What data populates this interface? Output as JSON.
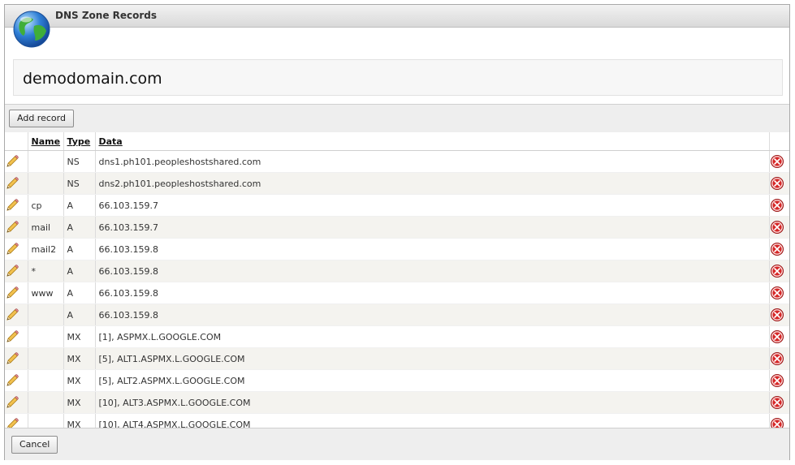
{
  "window": {
    "title": "DNS Zone Records"
  },
  "zone": {
    "domain": "demodomain.com"
  },
  "toolbar": {
    "add_label": "Add record"
  },
  "table": {
    "headers": {
      "name": "Name",
      "type": "Type",
      "data": "Data"
    },
    "rows": [
      {
        "name": "",
        "type": "NS",
        "data": "dns1.ph101.peopleshostshared.com"
      },
      {
        "name": "",
        "type": "NS",
        "data": "dns2.ph101.peopleshostshared.com"
      },
      {
        "name": "cp",
        "type": "A",
        "data": "66.103.159.7"
      },
      {
        "name": "mail",
        "type": "A",
        "data": "66.103.159.7"
      },
      {
        "name": "mail2",
        "type": "A",
        "data": "66.103.159.8"
      },
      {
        "name": "*",
        "type": "A",
        "data": "66.103.159.8"
      },
      {
        "name": "www",
        "type": "A",
        "data": "66.103.159.8"
      },
      {
        "name": "",
        "type": "A",
        "data": "66.103.159.8"
      },
      {
        "name": "",
        "type": "MX",
        "data": "[1], ASPMX.L.GOOGLE.COM"
      },
      {
        "name": "",
        "type": "MX",
        "data": "[5], ALT1.ASPMX.L.GOOGLE.COM"
      },
      {
        "name": "",
        "type": "MX",
        "data": "[5], ALT2.ASPMX.L.GOOGLE.COM"
      },
      {
        "name": "",
        "type": "MX",
        "data": "[10], ALT3.ASPMX.L.GOOGLE.COM"
      },
      {
        "name": "",
        "type": "MX",
        "data": "[10], ALT4.ASPMX.L.GOOGLE.COM"
      }
    ]
  },
  "footer": {
    "cancel_label": "Cancel"
  },
  "icons": {
    "header": "globe-icon",
    "edit": "pencil-icon",
    "delete": "delete-icon"
  },
  "colors": {
    "delete": "#d62828",
    "globe_blue": "#2f7fd6",
    "globe_green": "#3fae3a"
  }
}
